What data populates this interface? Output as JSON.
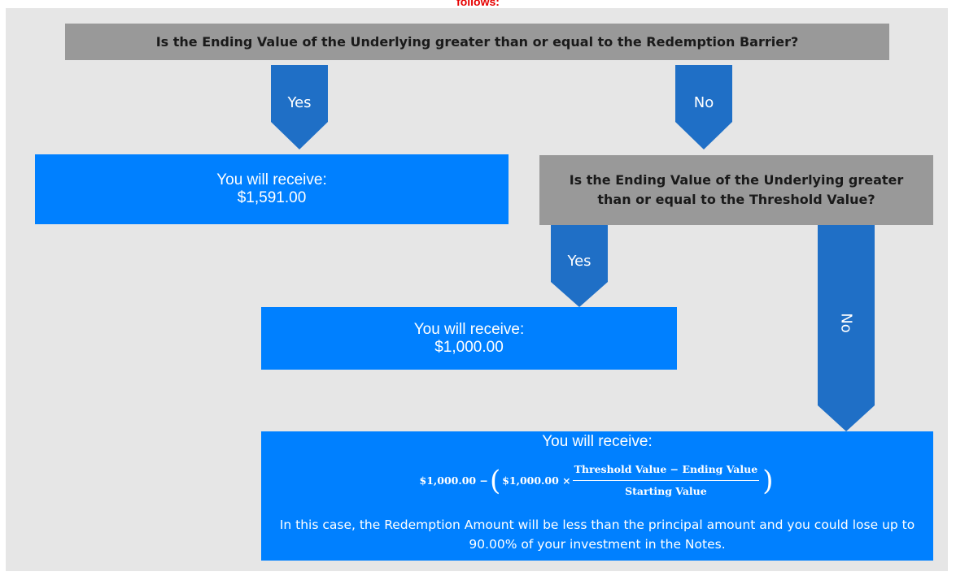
{
  "header_fragment": "follows:",
  "question_main": "Is the Ending Value of the Underlying greater than or equal to the Redemption Barrier?",
  "question_threshold": "Is the Ending Value of the Underlying greater than or equal to the Threshold Value?",
  "arrows": {
    "yes_1": "Yes",
    "no_1": "No",
    "yes_2": "Yes",
    "no_2": "No"
  },
  "outcome_1": {
    "title": "You will receive:",
    "amount": "$1,591.00"
  },
  "outcome_2": {
    "title": "You will receive:",
    "amount": "$1,000.00"
  },
  "outcome_3": {
    "title": "You will receive:",
    "formula_lead": "$1,000.00 −",
    "formula_inner": "$1,000.00 ×",
    "numerator": "Threshold Value − Ending Value",
    "denominator": "Starting Value",
    "note": "In this case, the Redemption Amount will be less than the principal amount and you could lose up to 90.00% of your investment in the Notes."
  },
  "colors": {
    "arrow_fill": "#1f6fc6",
    "answer_fill": "#0080ff",
    "question_fill": "#999999",
    "background": "#e6e6e6"
  }
}
